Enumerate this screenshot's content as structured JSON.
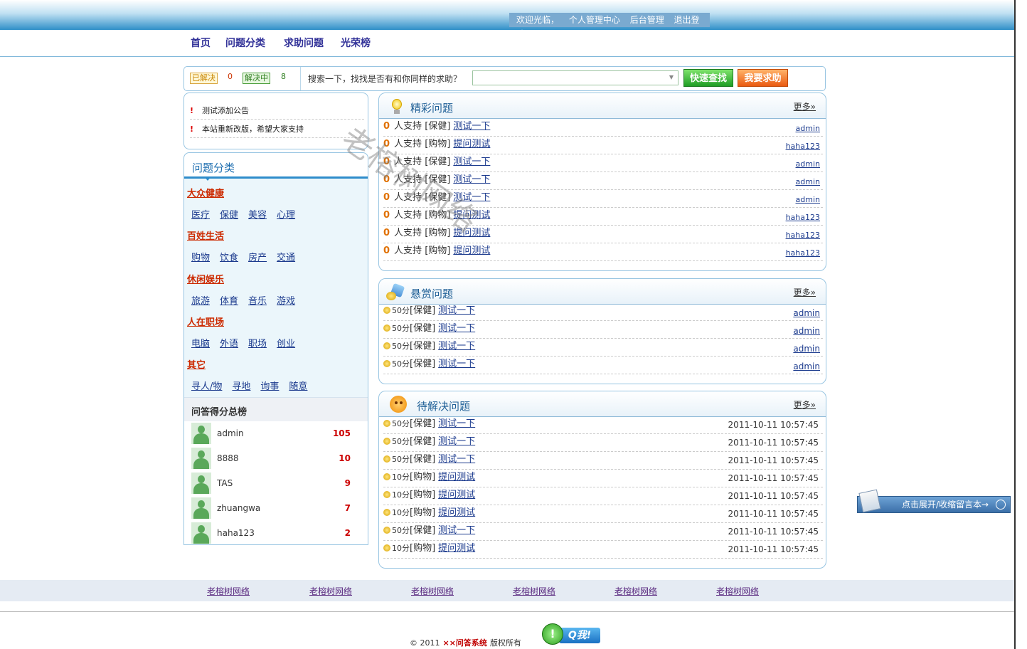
{
  "header": {
    "welcome": "欢迎光临，",
    "links": [
      "个人管理中心",
      "后台管理",
      "退出登陆"
    ]
  },
  "nav": [
    "首页",
    "问题分类",
    "求助问题",
    "光荣榜"
  ],
  "stats": {
    "solved_label": "已解决",
    "solved_count": "0",
    "solving_label": "解决中",
    "solving_count": "8",
    "search_label": "搜索一下，找找是否有和你同样的求助？",
    "search_value": "",
    "quick_button": "快速查找",
    "help_button": "我要求助"
  },
  "notices": [
    "测试添加公告",
    "本站重新改版，希望大家支持"
  ],
  "categories": {
    "title": "问题分类",
    "groups": [
      {
        "name": "大众健康",
        "items": [
          "医疗",
          "保健",
          "美容",
          "心理"
        ]
      },
      {
        "name": "百姓生活",
        "items": [
          "购物",
          "饮食",
          "房产",
          "交通"
        ]
      },
      {
        "name": "休闲娱乐",
        "items": [
          "旅游",
          "体育",
          "音乐",
          "游戏"
        ]
      },
      {
        "name": "人在职场",
        "items": [
          "电脑",
          "外语",
          "职场",
          "创业"
        ]
      },
      {
        "name": "其它",
        "items": [
          "寻人/物",
          "寻地",
          "询事",
          "随意"
        ]
      }
    ]
  },
  "ranking": {
    "title": "问答得分总榜",
    "rows": [
      {
        "user": "admin",
        "score": "105"
      },
      {
        "user": "8888",
        "score": "10"
      },
      {
        "user": "TAS",
        "score": "9"
      },
      {
        "user": "zhuangwa",
        "score": "7"
      },
      {
        "user": "haha123",
        "score": "2"
      }
    ]
  },
  "featured": {
    "title": "精彩问题",
    "more": "更多»",
    "rows": [
      {
        "num": "0",
        "support": "人支持",
        "cat": "[保健]",
        "q": "测试一下",
        "user": "admin"
      },
      {
        "num": "0",
        "support": "人支持",
        "cat": "[购物]",
        "q": "提问测试",
        "user": "haha123"
      },
      {
        "num": "0",
        "support": "人支持",
        "cat": "[保健]",
        "q": "测试一下",
        "user": "admin"
      },
      {
        "num": "0",
        "support": "人支持",
        "cat": "[保健]",
        "q": "测试一下",
        "user": "admin"
      },
      {
        "num": "0",
        "support": "人支持",
        "cat": "[保健]",
        "q": "测试一下",
        "user": "admin"
      },
      {
        "num": "0",
        "support": "人支持",
        "cat": "[购物]",
        "q": "提问测试",
        "user": "haha123"
      },
      {
        "num": "0",
        "support": "人支持",
        "cat": "[购物]",
        "q": "提问测试",
        "user": "haha123"
      },
      {
        "num": "0",
        "support": "人支持",
        "cat": "[购物]",
        "q": "提问测试",
        "user": "haha123"
      }
    ]
  },
  "reward": {
    "title": "悬赏问题",
    "more": "更多»",
    "rows": [
      {
        "score": "50分",
        "cat": "[保健]",
        "q": "测试一下",
        "user": "admin"
      },
      {
        "score": "50分",
        "cat": "[保健]",
        "q": "测试一下",
        "user": "admin"
      },
      {
        "score": "50分",
        "cat": "[保健]",
        "q": "测试一下",
        "user": "admin"
      },
      {
        "score": "50分",
        "cat": "[保健]",
        "q": "测试一下",
        "user": "admin"
      }
    ]
  },
  "pending": {
    "title": "待解决问题",
    "more": "更多»",
    "rows": [
      {
        "score": "50分",
        "cat": "[保健]",
        "q": "测试一下",
        "time": "2011-10-11 10:57:45"
      },
      {
        "score": "50分",
        "cat": "[保健]",
        "q": "测试一下",
        "time": "2011-10-11 10:57:45"
      },
      {
        "score": "50分",
        "cat": "[保健]",
        "q": "测试一下",
        "time": "2011-10-11 10:57:45"
      },
      {
        "score": "10分",
        "cat": "[购物]",
        "q": "提问测试",
        "time": "2011-10-11 10:57:45"
      },
      {
        "score": "10分",
        "cat": "[购物]",
        "q": "提问测试",
        "time": "2011-10-11 10:57:45"
      },
      {
        "score": "10分",
        "cat": "[购物]",
        "q": "提问测试",
        "time": "2011-10-11 10:57:45"
      },
      {
        "score": "50分",
        "cat": "[保健]",
        "q": "测试一下",
        "time": "2011-10-11 10:57:45"
      },
      {
        "score": "10分",
        "cat": "[购物]",
        "q": "提问测试",
        "time": "2011-10-11 10:57:45"
      }
    ]
  },
  "watermark": "老榕树网络",
  "message_toggle": "点击展开/收缩留言本→",
  "footer": {
    "links": [
      "老榕树网络",
      "老榕树网络",
      "老榕树网络",
      "老榕树网络",
      "老榕树网络",
      "老榕树网络"
    ],
    "copyright_prefix": "© 2011",
    "brand": "××问答系统",
    "copyright_suffix": "版权所有",
    "qq_label": "Q我!"
  }
}
